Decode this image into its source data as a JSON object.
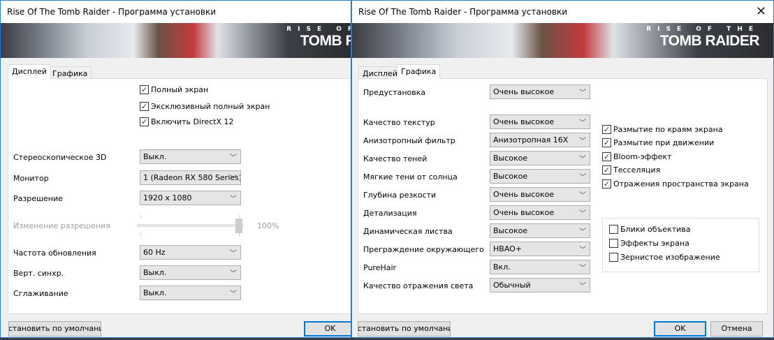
{
  "left_window": {
    "title": "Rise Of The Tomb Raider - Программа установки",
    "logo": {
      "line1": "RISE OF THE",
      "line2": "TOMB RAIDER"
    },
    "tabs": [
      {
        "label": "Дисплей",
        "active": true
      },
      {
        "label": "Графика",
        "active": false
      }
    ],
    "checkboxes": [
      {
        "label": "Полный экран",
        "checked": true
      },
      {
        "label": "Эксклюзивный полный экран",
        "checked": true
      },
      {
        "label": "Включить DirectX 12",
        "checked": true
      }
    ],
    "settings": [
      {
        "label": "Стереоскопическое 3D",
        "value": "Выкл."
      },
      {
        "label": "Монитор",
        "value": "1 (Radeon RX 580 Series)"
      },
      {
        "label": "Разрешение",
        "value": "1920 x 1080"
      },
      {
        "label": "Частота обновления",
        "value": "60 Hz"
      },
      {
        "label": "Верт. синхр.",
        "value": "Выкл."
      },
      {
        "label": "Сглаживание",
        "value": "Выкл."
      }
    ],
    "resolution_scale": {
      "label": "Изменение разрешения",
      "value_text": "100%",
      "value": 100,
      "enabled": false
    },
    "default_button": "Установить по умолчанию",
    "ok_button": "OK"
  },
  "right_window": {
    "title": "Rise Of The Tomb Raider - Программа установки",
    "logo": {
      "line1": "RISE OF THE",
      "line2": "TOMB RAIDER"
    },
    "tabs": [
      {
        "label": "Дисплей",
        "active": false
      },
      {
        "label": "Графика",
        "active": true
      }
    ],
    "preset": {
      "label": "Предустановка",
      "value": "Очень высокое"
    },
    "settings": [
      {
        "label": "Качество текстур",
        "value": "Очень высокое"
      },
      {
        "label": "Анизотропный фильтр",
        "value": "Анизотропная 16X"
      },
      {
        "label": "Качество теней",
        "value": "Высокое"
      },
      {
        "label": "Мягкие тени от солнца",
        "value": "Высокое"
      },
      {
        "label": "Глубина резкости",
        "value": "Очень высокое"
      },
      {
        "label": "Детализация",
        "value": "Очень высокое"
      },
      {
        "label": "Динамическая листва",
        "value": "Высокое"
      },
      {
        "label": "Преграждение окружающего",
        "value": "HBAO+"
      },
      {
        "label": "PureHair",
        "value": "Вкл."
      },
      {
        "label": "Качество отражения света",
        "value": "Обычный"
      }
    ],
    "effects": [
      {
        "label": "Размытие по краям экрана",
        "checked": true
      },
      {
        "label": "Размытие при движении",
        "checked": true
      },
      {
        "label": "Bloom-эффект",
        "checked": true
      },
      {
        "label": "Тесселяция",
        "checked": true
      },
      {
        "label": "Отражения пространства экрана",
        "checked": true
      }
    ],
    "extra_effects": [
      {
        "label": "Блики объектива",
        "checked": false
      },
      {
        "label": "Эффекты экрана",
        "checked": false
      },
      {
        "label": "Зернистое изображение",
        "checked": false
      }
    ],
    "default_button": "Установить по умолчанию",
    "ok_button": "OK",
    "cancel_button": "Отмена"
  }
}
